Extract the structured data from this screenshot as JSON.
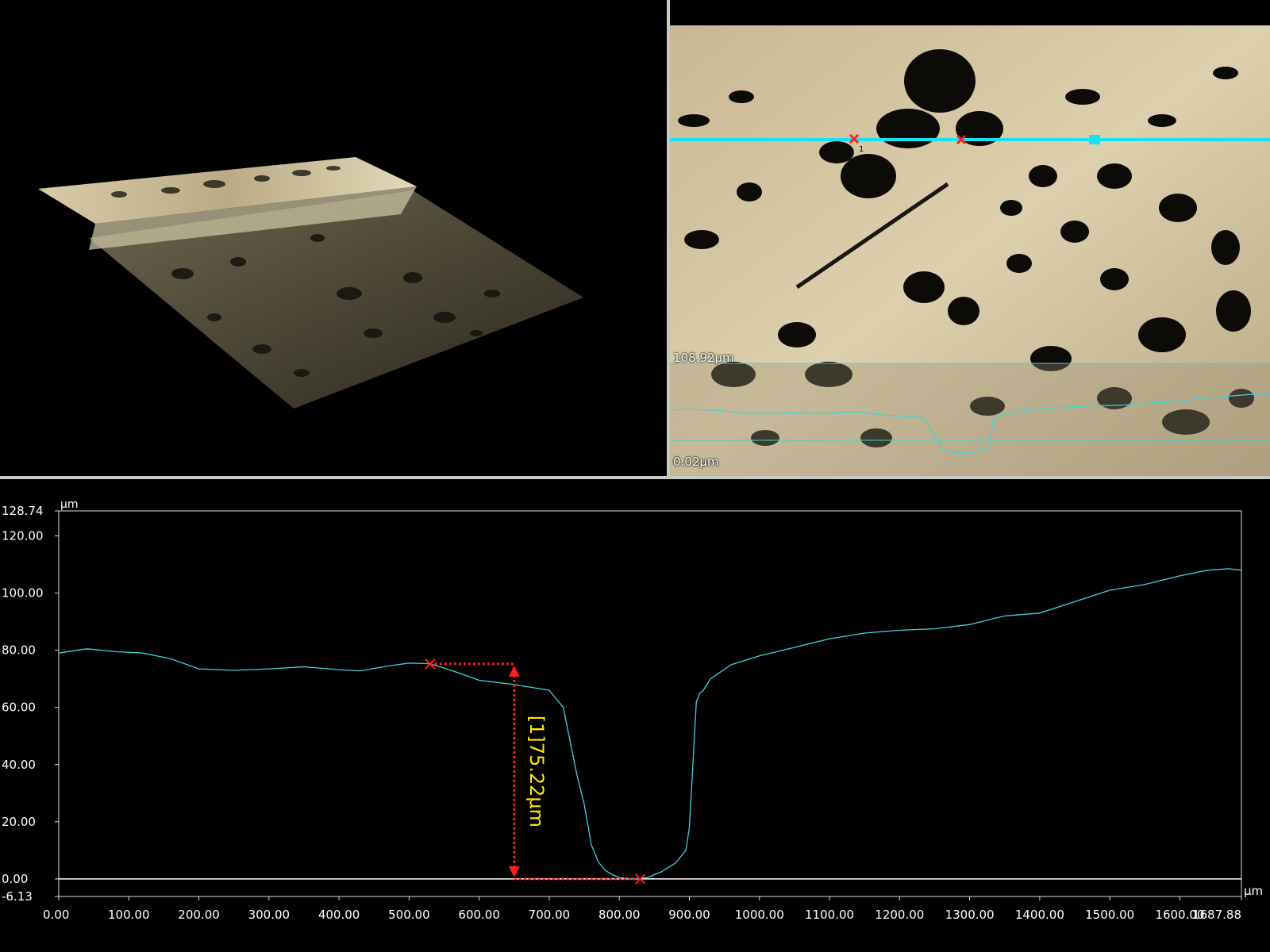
{
  "image_view": {
    "scale_top": "108.92μm",
    "scale_bottom": "0.02μm",
    "marker_label": "1"
  },
  "colors": {
    "profile_line": "#3fd3dc",
    "measure": "#ff1e1e",
    "measure_label": "#ffe600",
    "scan_line": "#19e2f0"
  },
  "chart_data": {
    "type": "line",
    "y_unit": "μm",
    "x_unit": "μm",
    "ylim": [
      -6.13,
      128.74
    ],
    "xlim": [
      0.0,
      1687.88
    ],
    "y_ticks": [
      "128.74",
      "120.00",
      "100.00",
      "80.00",
      "60.00",
      "40.00",
      "20.00",
      "0.00",
      "-6.13"
    ],
    "x_ticks": [
      "0.00",
      "100.00",
      "200.00",
      "300.00",
      "400.00",
      "500.00",
      "600.00",
      "700.00",
      "800.00",
      "900.00",
      "1000.00",
      "1100.00",
      "1200.00",
      "1300.00",
      "1400.00",
      "1500.00",
      "1600.00",
      "1687.88"
    ],
    "series": [
      {
        "x": [
          0,
          40,
          80,
          120,
          160,
          200,
          250,
          300,
          350,
          400,
          430,
          470,
          500,
          530,
          560,
          600,
          650,
          700,
          720,
          730,
          740,
          750,
          760,
          770,
          780,
          790,
          800,
          820,
          840,
          860,
          880,
          895,
          900,
          905,
          910,
          915,
          920,
          930,
          960,
          1000,
          1050,
          1100,
          1150,
          1200,
          1250,
          1300,
          1350,
          1400,
          1450,
          1500,
          1550,
          1600,
          1640,
          1670,
          1687.88
        ],
        "y": [
          79,
          80.5,
          79.5,
          79,
          77,
          73.5,
          73,
          73.5,
          74.2,
          73.2,
          72.8,
          74.5,
          75.5,
          75.3,
          73,
          69.5,
          68,
          66,
          60,
          48,
          36,
          26,
          12,
          6,
          3,
          1.5,
          0.5,
          0,
          0.5,
          2.5,
          5.5,
          10,
          18,
          40,
          62,
          65,
          66,
          70,
          75,
          78,
          81,
          84,
          86,
          87,
          87.5,
          89,
          92,
          93,
          97,
          101,
          103,
          106,
          108,
          108.5,
          108
        ]
      }
    ],
    "measurement": {
      "label": "[1]75.22μm",
      "p1": [
        530,
        75.22
      ],
      "p2": [
        830,
        0.0
      ],
      "arrow_x": 650
    }
  }
}
